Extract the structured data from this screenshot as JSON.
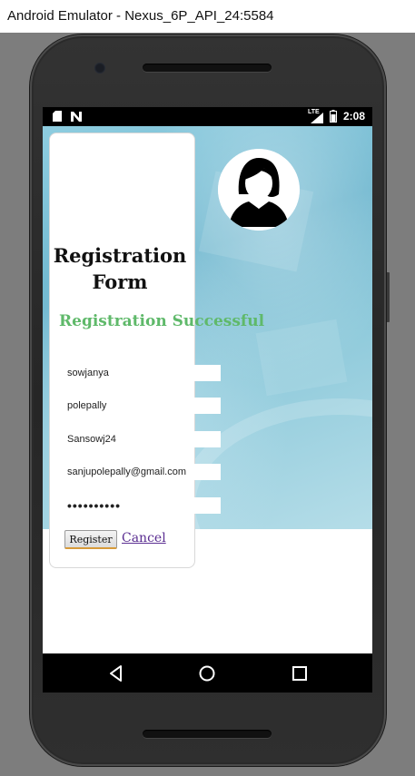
{
  "window": {
    "title": "Android Emulator - Nexus_6P_API_24:5584"
  },
  "statusbar": {
    "time": "2:08",
    "network_label": "LTE",
    "left_icons": [
      "sd-card-icon",
      "n-notification-icon"
    ],
    "right_icons": [
      "lte-signal-icon",
      "battery-icon"
    ]
  },
  "form": {
    "title": "Registration Form",
    "success_message": "Registration Successful",
    "fields": {
      "first_name": "sowjanya",
      "last_name": "polepally",
      "username": "Sansowj24",
      "email": "sanjupolepally@gmail.com",
      "password": "••••••••••"
    },
    "register_label": "Register",
    "cancel_label": "Cancel"
  },
  "navbar": {
    "buttons": [
      "back-icon",
      "home-icon",
      "recents-icon"
    ]
  },
  "colors": {
    "success_green": "#5fb96a",
    "cancel_link": "#5a2d91",
    "background_blue": "#8ecde0",
    "status_bar": "#000000"
  }
}
